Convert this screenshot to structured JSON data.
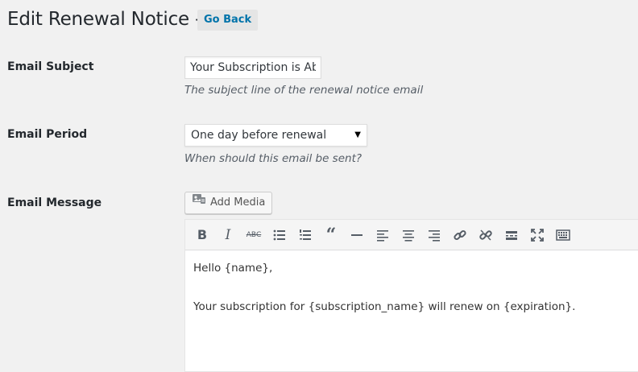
{
  "header": {
    "title": "Edit Renewal Notice -",
    "go_back_label": "Go Back"
  },
  "fields": {
    "subject": {
      "label": "Email Subject",
      "value": "Your Subscription is Abo",
      "description": "The subject line of the renewal notice email"
    },
    "period": {
      "label": "Email Period",
      "selected": "One day before renewal",
      "description": "When should this email be sent?"
    },
    "message": {
      "label": "Email Message",
      "add_media_label": "Add Media",
      "content_lines": [
        "Hello {name},",
        "Your subscription for {subscription_name} will renew on {expiration}."
      ]
    }
  },
  "toolbar": {
    "buttons": [
      {
        "icon": "bold-icon"
      },
      {
        "icon": "italic-icon"
      },
      {
        "icon": "strikethrough-icon"
      },
      {
        "icon": "bullet-list-icon"
      },
      {
        "icon": "numbered-list-icon"
      },
      {
        "icon": "blockquote-icon"
      },
      {
        "icon": "horizontal-line-icon"
      },
      {
        "icon": "align-left-icon"
      },
      {
        "icon": "align-center-icon"
      },
      {
        "icon": "align-right-icon"
      },
      {
        "icon": "link-icon"
      },
      {
        "icon": "unlink-icon"
      },
      {
        "icon": "read-more-icon"
      },
      {
        "icon": "fullscreen-icon"
      },
      {
        "icon": "toolbar-toggle-icon"
      }
    ]
  }
}
